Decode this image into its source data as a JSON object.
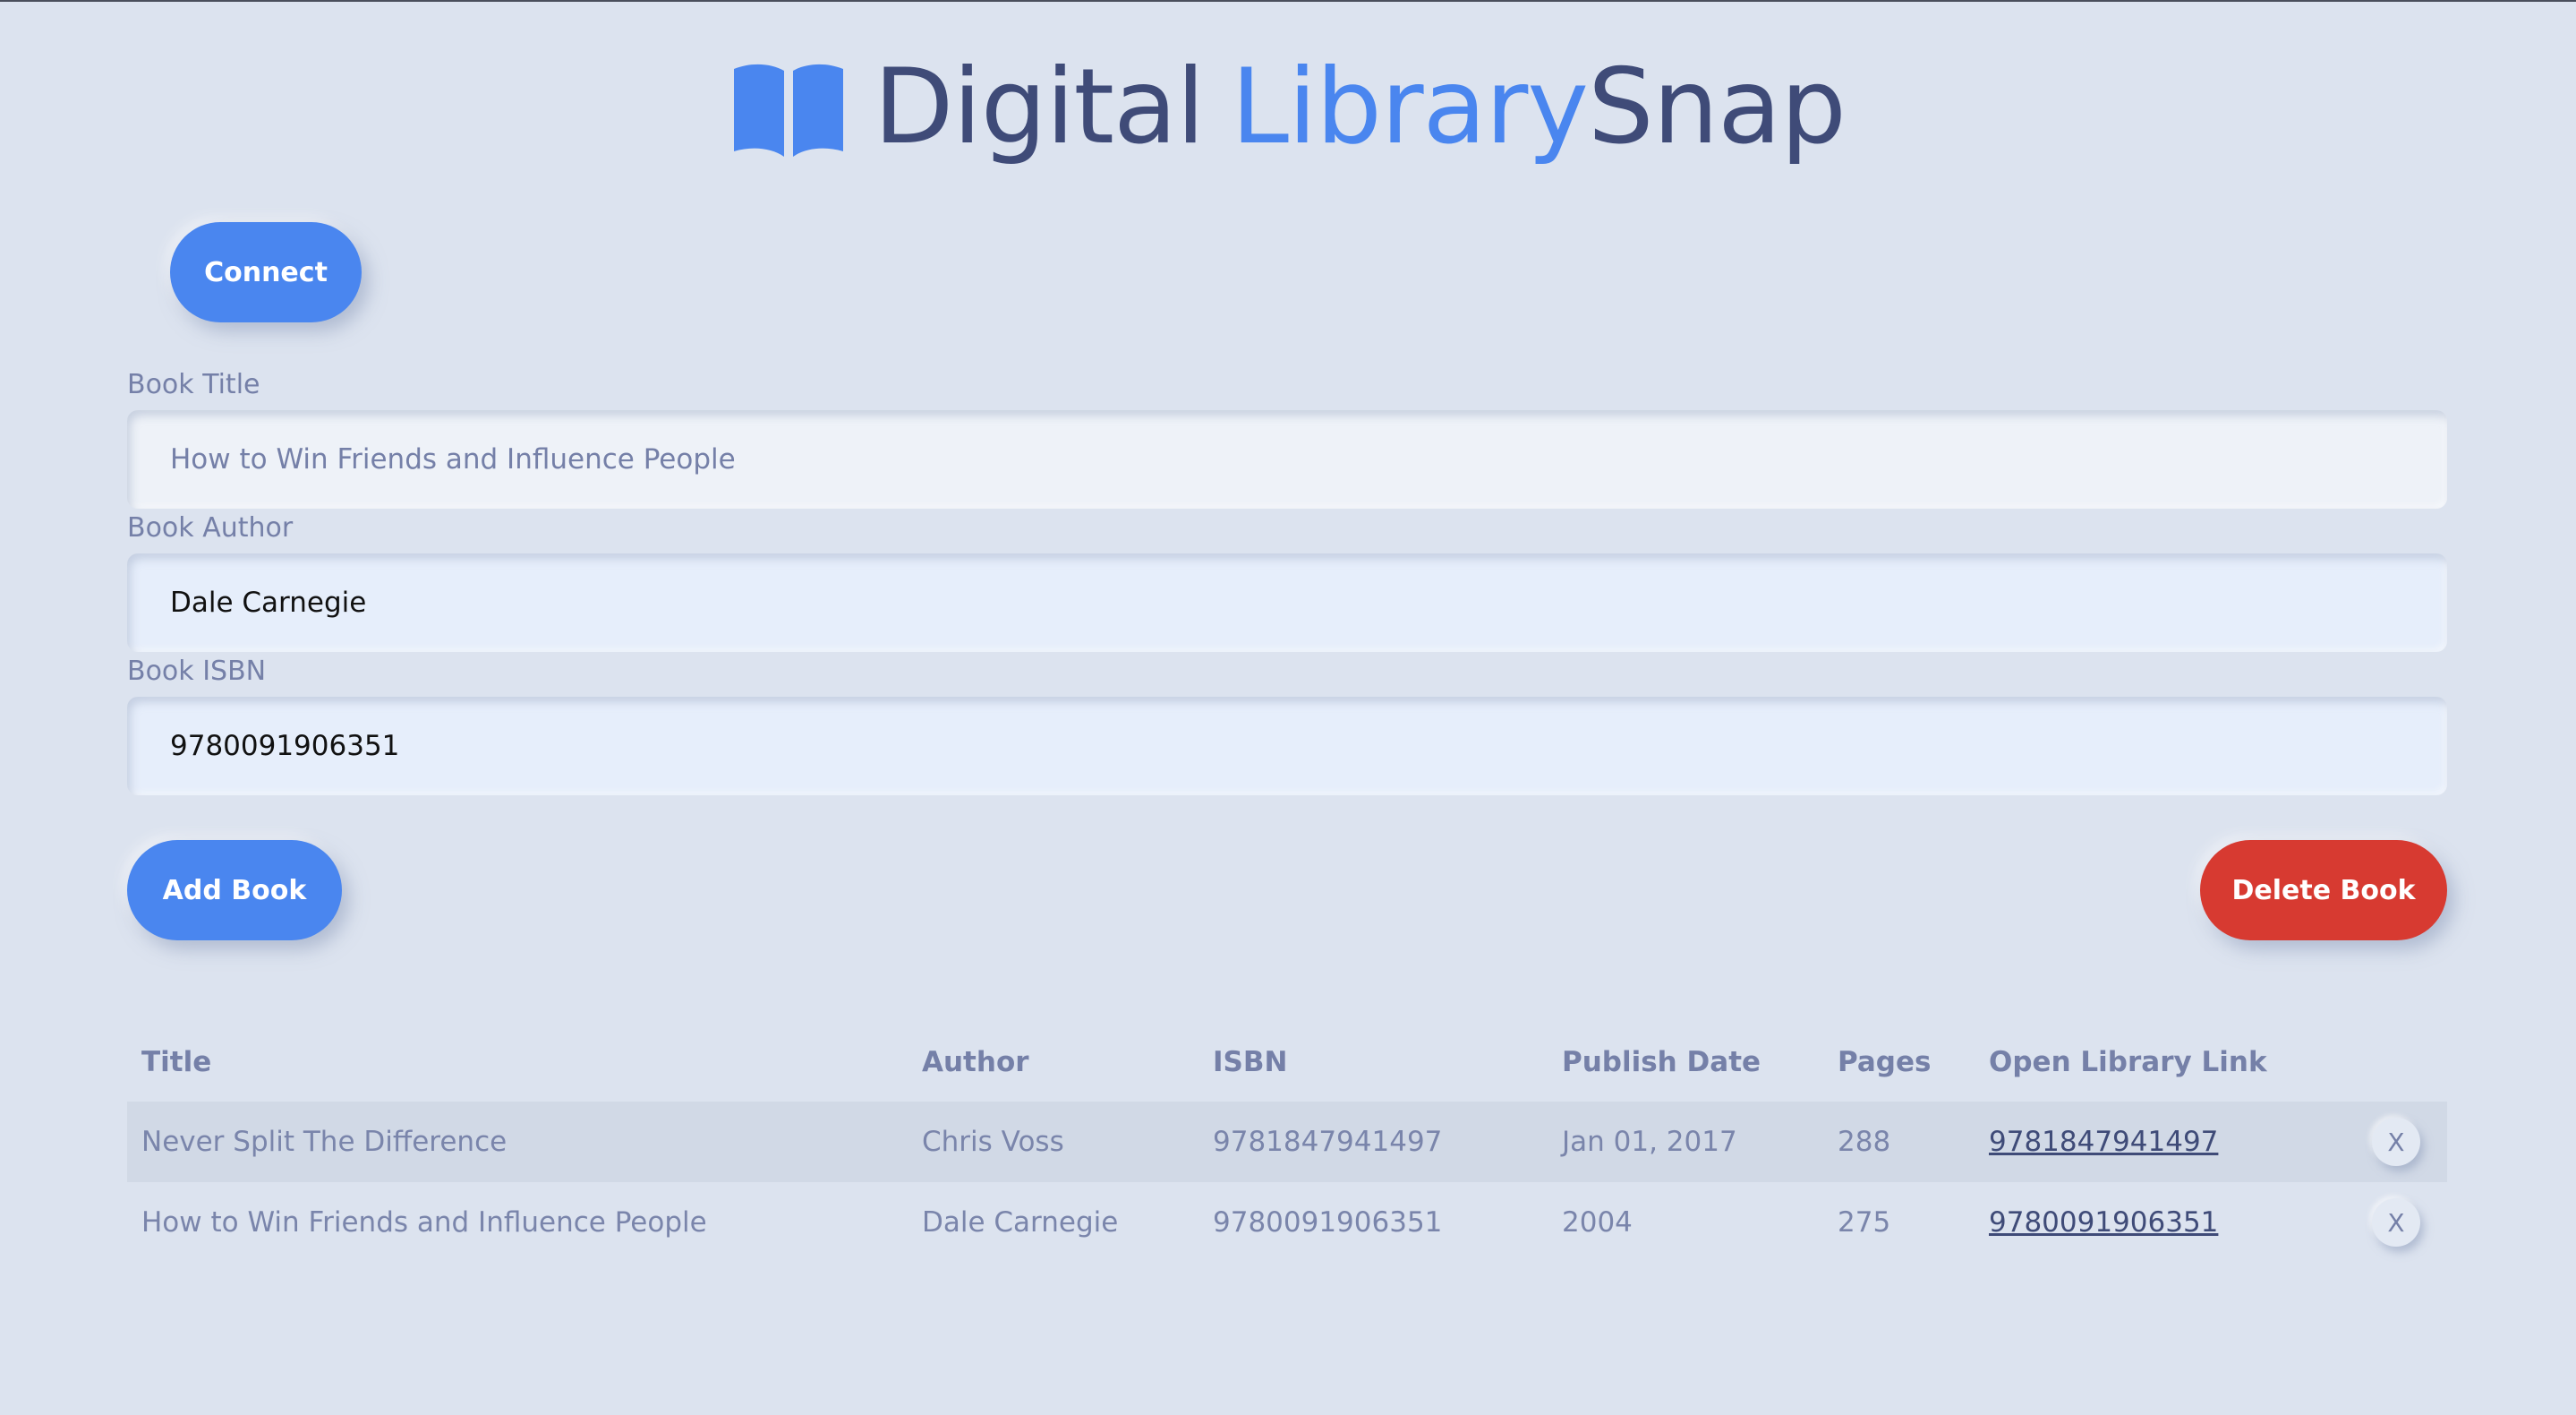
{
  "header": {
    "icon": "open-book-icon",
    "title_part1": "Digital",
    "title_part2": "Library",
    "title_part3": "Snap"
  },
  "colors": {
    "accent": "#4a86ef",
    "danger": "#d73a31",
    "background": "#dce3ef",
    "title": "#3f4b78"
  },
  "buttons": {
    "connect": "Connect",
    "add": "Add Book",
    "delete": "Delete Book"
  },
  "form": {
    "title_label": "Book Title",
    "title_placeholder": "How to Win Friends and Influence People",
    "author_label": "Book Author",
    "author_value": "Dale Carnegie",
    "isbn_label": "Book ISBN",
    "isbn_value": "9780091906351"
  },
  "table": {
    "headers": [
      "Title",
      "Author",
      "ISBN",
      "Publish Date",
      "Pages",
      "Open Library Link"
    ],
    "rows": [
      {
        "title": "Never Split The Difference",
        "author": "Chris Voss",
        "isbn": "9781847941497",
        "publish_date": "Jan 01, 2017",
        "pages": "288",
        "link": "9781847941497",
        "remove": "X"
      },
      {
        "title": "How to Win Friends and Influence People",
        "author": "Dale Carnegie",
        "isbn": "9780091906351",
        "publish_date": "2004",
        "pages": "275",
        "link": "9780091906351",
        "remove": "X"
      }
    ]
  }
}
